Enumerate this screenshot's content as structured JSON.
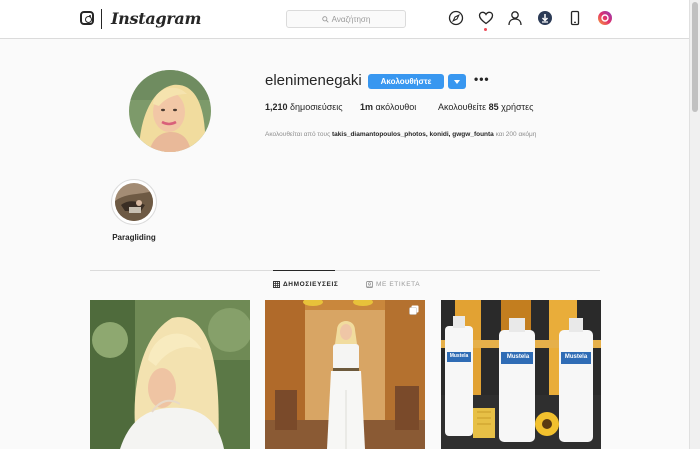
{
  "header": {
    "brand": "Instagram",
    "search_placeholder": "Αναζήτηση"
  },
  "profile": {
    "username": "elenimenegaki",
    "follow_label": "Ακολουθήστε",
    "more_label": "•••",
    "stats": {
      "posts_count": "1,210",
      "posts_label": "δημοσιεύσεις",
      "followers_count": "1m",
      "followers_label": "ακόλουθοι",
      "following_prefix": "Ακολουθείτε",
      "following_count": "85",
      "following_suffix": "χρήστες"
    },
    "followed_by": {
      "prefix": "Ακολουθείται από τους",
      "names": "takis_diamantopoulos_photos, konidi, gwgw_founta",
      "suffix": "και 200 ακόμη"
    }
  },
  "highlights": [
    {
      "label": "Paragliding"
    }
  ],
  "tabs": [
    {
      "label": "ΔΗΜΟΣΙΕΥΣΕΙΣ",
      "icon": "grid-icon",
      "active": true
    },
    {
      "label": "ΜΕ ΕΤΙΚΕΤΑ",
      "icon": "tagged-icon",
      "active": false
    }
  ],
  "posts": [
    {
      "kind": "portrait photo",
      "multi": false
    },
    {
      "kind": "studio outfit photo",
      "multi": true
    },
    {
      "kind": "product photo",
      "multi": false,
      "brand_text": "Mustela"
    }
  ],
  "colors": {
    "accent": "#3897f0",
    "text": "#262626",
    "muted": "#8e8e8e",
    "border": "#dbdbdb"
  }
}
